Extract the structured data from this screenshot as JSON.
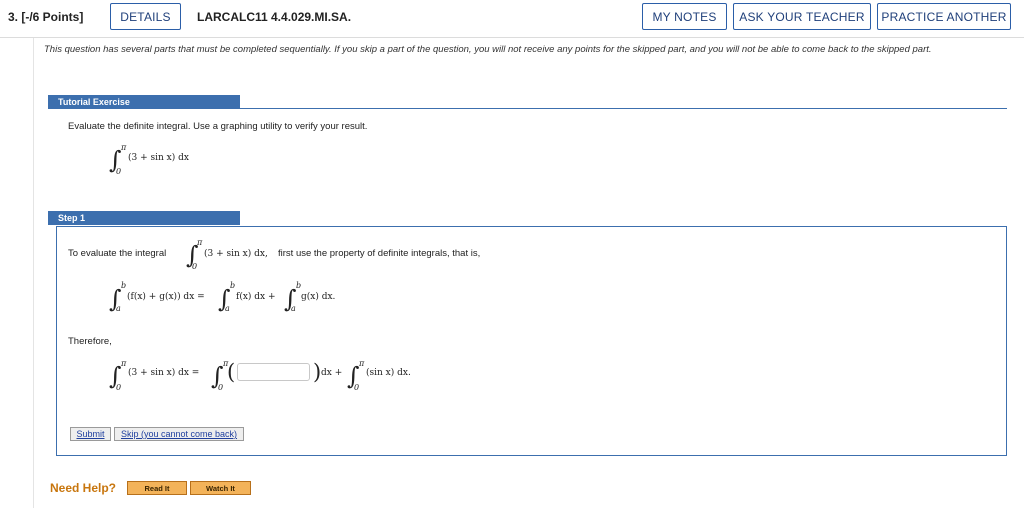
{
  "header": {
    "points": "3. [-/6 Points]",
    "details_label": "DETAILS",
    "question_id": "LARCALC11 4.4.029.MI.SA.",
    "my_notes_label": "MY NOTES",
    "ask_teacher_label": "ASK YOUR TEACHER",
    "practice_another_label": "PRACTICE ANOTHER"
  },
  "notice": "This question has several parts that must be completed sequentially. If you skip a part of the question, you will not receive any points for the skipped part, and you will not be able to come back to the skipped part.",
  "tutorial": {
    "tab_label": "Tutorial Exercise",
    "prompt": "Evaluate the definite integral. Use a graphing utility to verify your result.",
    "integral": {
      "lower": "0",
      "upper": "π",
      "integrand": "(3 + sin x) dx"
    }
  },
  "step1": {
    "tab_label": "Step 1",
    "intro_before": "To evaluate the integral",
    "intro_integrand": "(3 + sin x) dx,",
    "intro_after": "first use the property of definite integrals, that is,",
    "property": {
      "lower": "a",
      "upper": "b",
      "lhs": "(f(x) + g(x)) dx =",
      "rhs1": "f(x) dx +",
      "rhs2": "g(x) dx."
    },
    "therefore_label": "Therefore,",
    "result": {
      "lhs": "(3 + sin x) dx =",
      "after_blank": "dx +",
      "last": "(sin x) dx."
    },
    "answer_value": "",
    "submit_label": "Submit",
    "skip_label": "Skip (you cannot come back)"
  },
  "help": {
    "label": "Need Help?",
    "read_label": "Read It",
    "watch_label": "Watch It"
  },
  "colors": {
    "accent": "#3c6fae",
    "button_border": "#2b5ea8",
    "help_orange": "#c8760e",
    "help_button": "#f3b35a"
  }
}
